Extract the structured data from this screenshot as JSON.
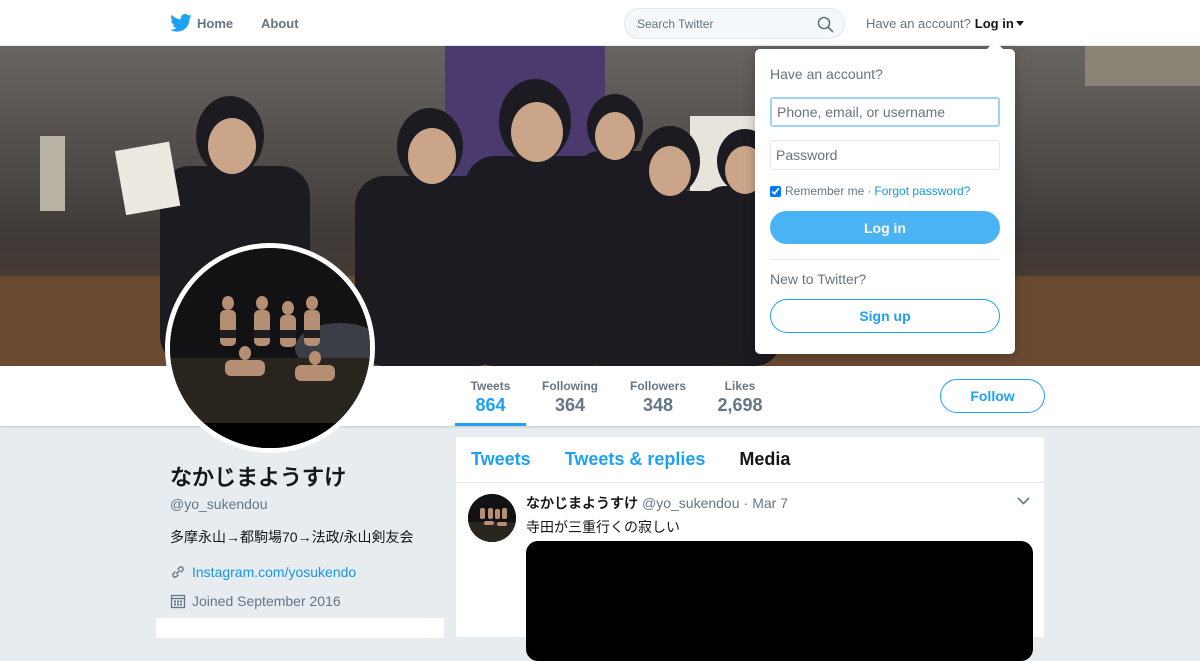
{
  "nav": {
    "home_label": "Home",
    "about_label": "About",
    "search_placeholder": "Search Twitter",
    "account_prompt": "Have an account?",
    "login_label": "Log in"
  },
  "login_dropdown": {
    "title": "Have an account?",
    "username_placeholder": "Phone, email, or username",
    "password_placeholder": "Password",
    "remember_label": "Remember me",
    "separator": "·",
    "forgot_label": "Forgot password?",
    "login_button": "Log in",
    "new_prompt": "New to Twitter?",
    "signup_button": "Sign up"
  },
  "stats": [
    {
      "label": "Tweets",
      "value": "864"
    },
    {
      "label": "Following",
      "value": "364"
    },
    {
      "label": "Followers",
      "value": "348"
    },
    {
      "label": "Likes",
      "value": "2,698"
    }
  ],
  "follow_label": "Follow",
  "profile": {
    "name": "なかじまようすけ",
    "handle": "@yo_sukendou",
    "bio": "多摩永山→都駒場70→法政/永山剣友会",
    "link": "Instagram.com/yosukendo",
    "joined": "Joined September 2016"
  },
  "timeline": {
    "tabs": [
      "Tweets",
      "Tweets & replies",
      "Media"
    ],
    "tweet": {
      "name": "なかじまようすけ",
      "handle": "@yo_sukendou",
      "dot": "·",
      "date": "Mar 7",
      "text": "寺田が三重行くの寂しい"
    }
  },
  "colors": {
    "accent": "#1da1f2",
    "login_button": "#4ab3f4",
    "background": "#e6ecf0"
  }
}
